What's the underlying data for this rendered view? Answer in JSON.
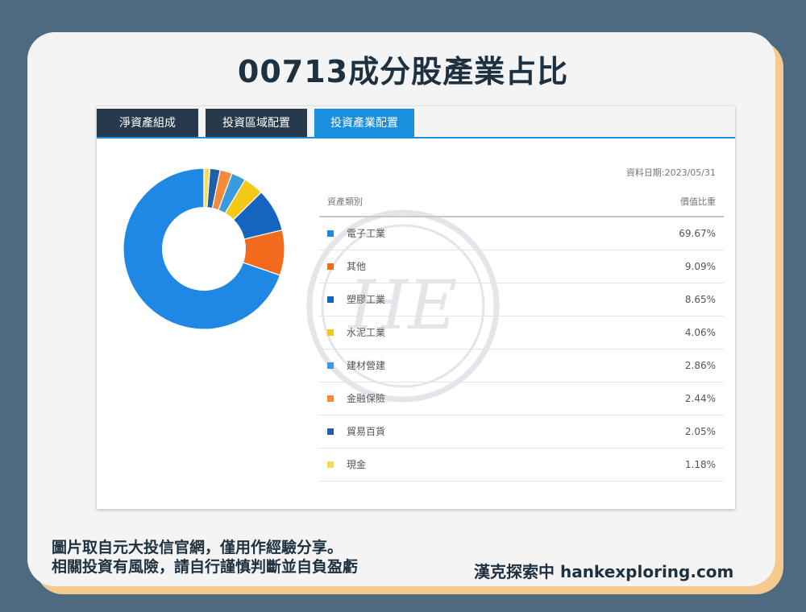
{
  "title": "00713成分股產業占比",
  "tabs": [
    {
      "label": "淨資產組成",
      "active": false
    },
    {
      "label": "投資區域配置",
      "active": false
    },
    {
      "label": "投資產業配置",
      "active": true
    }
  ],
  "date_label": "資料日期:2023/05/31",
  "table": {
    "col_category": "資產類別",
    "col_weight": "價值比重"
  },
  "watermark_text": "HE",
  "chart_data": {
    "type": "pie",
    "donut": true,
    "categories": [
      "電子工業",
      "其他",
      "塑膠工業",
      "水泥工業",
      "建材營建",
      "金融保險",
      "貿易百貨",
      "現金"
    ],
    "values": [
      69.67,
      9.09,
      8.65,
      4.06,
      2.86,
      2.44,
      2.05,
      1.18
    ],
    "value_labels": [
      "69.67%",
      "9.09%",
      "8.65%",
      "4.06%",
      "2.86%",
      "2.44%",
      "2.05%",
      "1.18%"
    ],
    "colors": [
      "#1f88e5",
      "#f26b1d",
      "#1565c0",
      "#f5c818",
      "#3b9be0",
      "#f58a3c",
      "#1e5fa8",
      "#f7dc5c"
    ],
    "direction": "counterclockwise from top"
  },
  "footer": {
    "line1": "圖片取自元大投信官網，僅用作經驗分享。",
    "line2": "相關投資有風險，請自行謹慎判斷並自負盈虧",
    "brand": "漢克探索中 hankexploring.com"
  }
}
